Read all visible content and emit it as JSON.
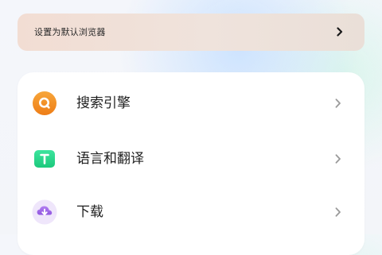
{
  "default_browser_banner": {
    "label": "设置为默认浏览器",
    "icon": "chevron-right-icon"
  },
  "settings": {
    "items": [
      {
        "label": "搜索引擎",
        "icon": "search-engine-icon",
        "icon_color": "#f28a1c",
        "chevron": "chevron-right-icon"
      },
      {
        "label": "语言和翻译",
        "icon": "language-translate-icon",
        "icon_color": "#27d98d",
        "chevron": "chevron-right-icon"
      },
      {
        "label": "下载",
        "icon": "download-icon",
        "icon_color": "#a56be8",
        "chevron": "chevron-right-icon"
      }
    ]
  }
}
